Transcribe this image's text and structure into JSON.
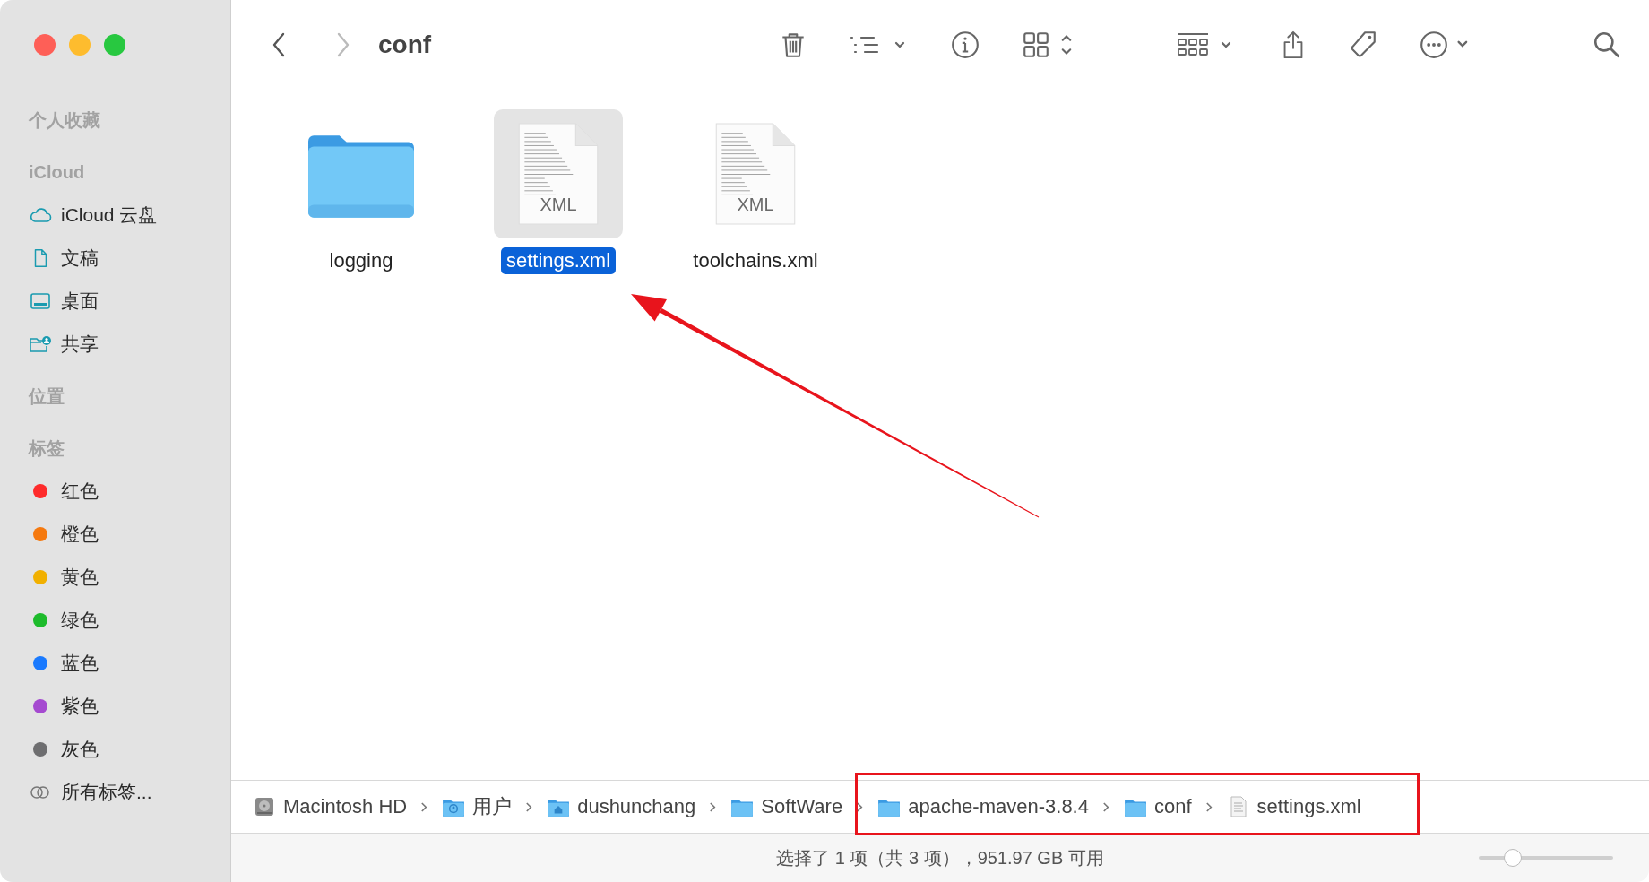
{
  "window": {
    "title": "conf"
  },
  "sidebar": {
    "sections": [
      {
        "title": "个人收藏"
      },
      {
        "title": "iCloud",
        "items": [
          {
            "label": "iCloud 云盘",
            "kind": "cloud"
          },
          {
            "label": "文稿",
            "kind": "document"
          },
          {
            "label": "桌面",
            "kind": "desktop"
          },
          {
            "label": "共享",
            "kind": "shared"
          }
        ]
      },
      {
        "title": "位置"
      },
      {
        "title": "标签",
        "items": [
          {
            "label": "红色",
            "kind": "tag",
            "color": "#fe2b2b"
          },
          {
            "label": "橙色",
            "kind": "tag",
            "color": "#f5790f"
          },
          {
            "label": "黄色",
            "kind": "tag",
            "color": "#f1b000"
          },
          {
            "label": "绿色",
            "kind": "tag",
            "color": "#1dbb2b"
          },
          {
            "label": "蓝色",
            "kind": "tag",
            "color": "#1a7afe"
          },
          {
            "label": "紫色",
            "kind": "tag",
            "color": "#a54ad0"
          },
          {
            "label": "灰色",
            "kind": "tag",
            "color": "#6e6e70"
          },
          {
            "label": "所有标签...",
            "kind": "all-tags"
          }
        ]
      }
    ]
  },
  "files": [
    {
      "name": "logging",
      "kind": "folder",
      "selected": false
    },
    {
      "name": "settings.xml",
      "kind": "document",
      "badge": "XML",
      "selected": true
    },
    {
      "name": "toolchains.xml",
      "kind": "document",
      "badge": "XML",
      "selected": false
    }
  ],
  "path_bar": [
    {
      "label": "Macintosh HD",
      "kind": "disk"
    },
    {
      "label": "用户",
      "kind": "users-folder"
    },
    {
      "label": "dushunchang",
      "kind": "home-folder"
    },
    {
      "label": "SoftWare",
      "kind": "folder"
    },
    {
      "label": "apache-maven-3.8.4",
      "kind": "folder"
    },
    {
      "label": "conf",
      "kind": "folder"
    },
    {
      "label": "settings.xml",
      "kind": "file"
    }
  ],
  "status_bar": {
    "text": "选择了 1 项（共 3 项），951.97 GB 可用",
    "icon_size": {
      "level": 0.25
    }
  }
}
